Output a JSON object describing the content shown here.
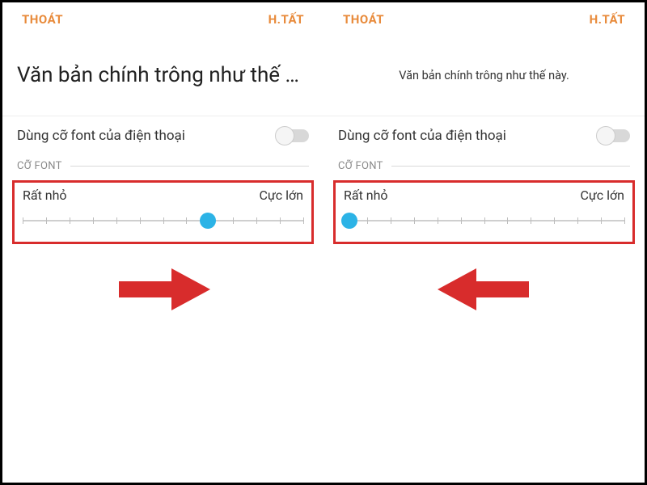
{
  "left": {
    "header": {
      "exit": "THOÁT",
      "done": "H.TẤT"
    },
    "preview_text": "Văn bản chính trông như thế này.",
    "toggle_label": "Dùng cỡ font của điện thoại",
    "section_title": "CỠ FONT",
    "slider": {
      "min_label": "Rất nhỏ",
      "max_label": "Cực lớn",
      "pos_percent": 66
    },
    "arrow_dir": "right"
  },
  "right": {
    "header": {
      "exit": "THOÁT",
      "done": "H.TẤT"
    },
    "preview_text": "Văn bản chính trông như thế này.",
    "toggle_label": "Dùng cỡ font của điện thoại",
    "section_title": "CỠ FONT",
    "slider": {
      "min_label": "Rất nhỏ",
      "max_label": "Cực lớn",
      "pos_percent": 2
    },
    "arrow_dir": "left"
  },
  "colors": {
    "accent": "#e88a3a",
    "highlight": "#d82c2c",
    "thumb": "#2cb3e6"
  }
}
